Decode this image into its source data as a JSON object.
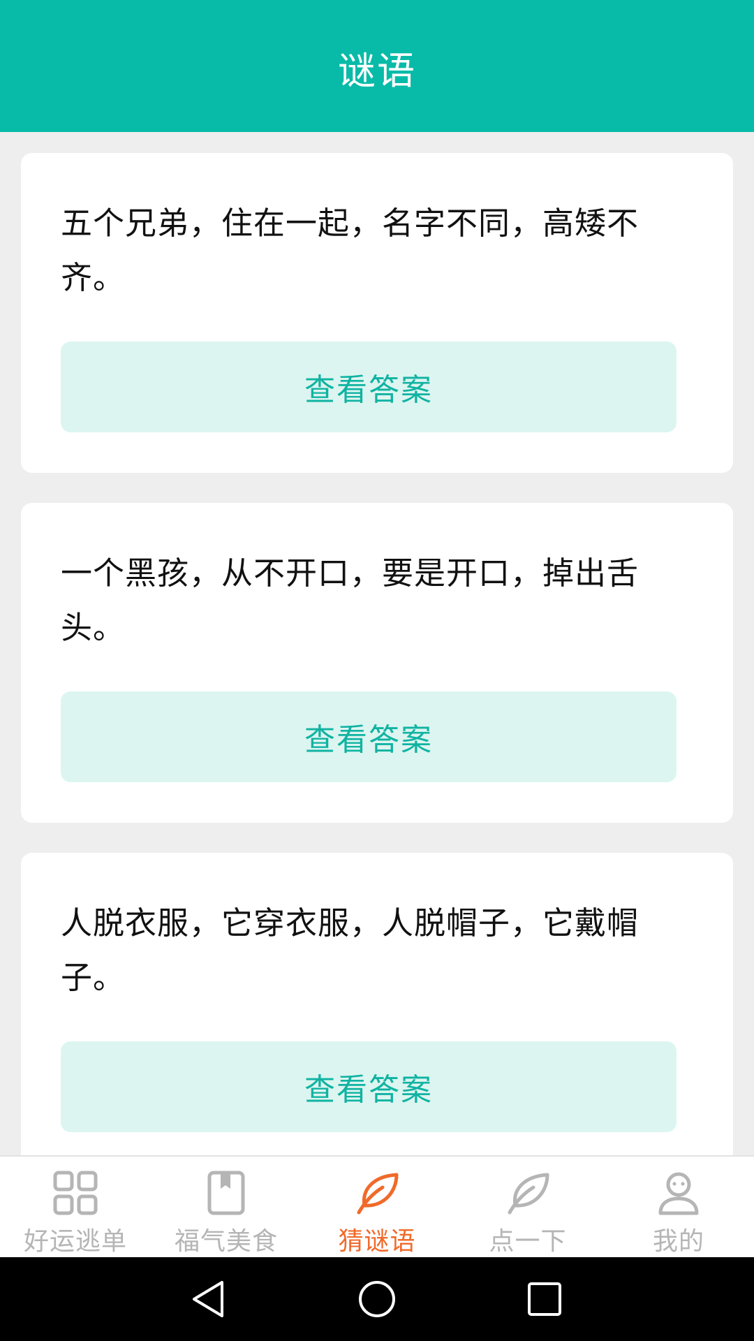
{
  "header": {
    "title": "谜语",
    "background_color": "#07bba8"
  },
  "riddles": [
    {
      "question": "五个兄弟，住在一起，名字不同，高矮不齐。",
      "button_label": "查看答案"
    },
    {
      "question": "一个黑孩，从不开口，要是开口，掉出舌头。",
      "button_label": "查看答案"
    },
    {
      "question": "人脱衣服，它穿衣服，人脱帽子，它戴帽子。",
      "button_label": "查看答案"
    }
  ],
  "tabbar": {
    "items": [
      {
        "label": "好运逃单",
        "icon": "grid-icon",
        "active": false
      },
      {
        "label": "福气美食",
        "icon": "book-icon",
        "active": false
      },
      {
        "label": "猜谜语",
        "icon": "leaf-icon",
        "active": true
      },
      {
        "label": "点一下",
        "icon": "leaf-icon",
        "active": false
      },
      {
        "label": "我的",
        "icon": "user-icon",
        "active": false
      }
    ],
    "active_color": "#f06a2a",
    "inactive_color": "#b5b5b5"
  },
  "system_nav": {
    "buttons": [
      "back-icon",
      "home-icon",
      "recents-icon"
    ]
  }
}
